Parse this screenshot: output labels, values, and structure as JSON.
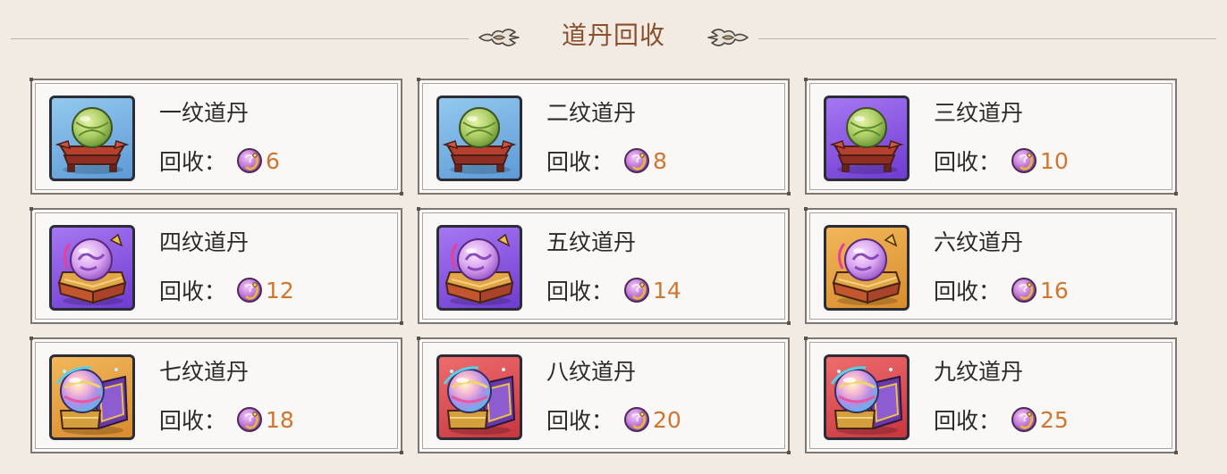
{
  "header": {
    "title": "道丹回收",
    "ornament_icon": "cloud-ornament-icon"
  },
  "recycle": {
    "label": "回收：",
    "currency_icon": "dao-coin-icon",
    "colors": {
      "title": "#8a4f2c",
      "price_value": "#d2752f"
    },
    "items": [
      {
        "name": "一纹道丹",
        "value": "6",
        "rarity": "blue",
        "icon": "green-orb-pedestal-icon"
      },
      {
        "name": "二纹道丹",
        "value": "8",
        "rarity": "blue",
        "icon": "green-orb-pedestal-icon"
      },
      {
        "name": "三纹道丹",
        "value": "10",
        "rarity": "purple",
        "icon": "green-orb-pedestal-icon"
      },
      {
        "name": "四纹道丹",
        "value": "12",
        "rarity": "purple",
        "icon": "purple-orb-chest-icon"
      },
      {
        "name": "五纹道丹",
        "value": "14",
        "rarity": "purple",
        "icon": "purple-orb-chest-icon"
      },
      {
        "name": "六纹道丹",
        "value": "16",
        "rarity": "orange",
        "icon": "purple-orb-chest-icon"
      },
      {
        "name": "七纹道丹",
        "value": "18",
        "rarity": "orange",
        "icon": "rainbow-orb-chest-icon"
      },
      {
        "name": "八纹道丹",
        "value": "20",
        "rarity": "red",
        "icon": "rainbow-orb-chest-icon"
      },
      {
        "name": "九纹道丹",
        "value": "25",
        "rarity": "red",
        "icon": "rainbow-orb-chest-icon"
      }
    ]
  }
}
